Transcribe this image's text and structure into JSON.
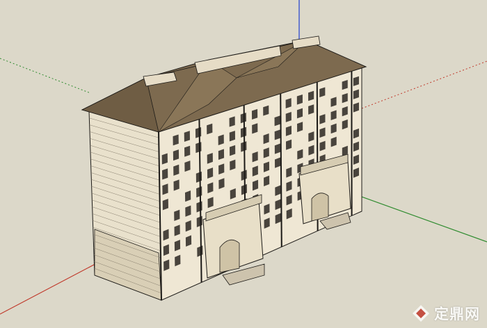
{
  "viewport": {
    "background_color": "#dcd8c9",
    "axis_colors": {
      "red": "#c0392b",
      "green": "#2e8b2e",
      "blue": "#1f3fd0"
    }
  },
  "model": {
    "roof_color": "#7d6a4f",
    "wall_color": "#efe7d4",
    "window_color": "#2b2722",
    "outline_color": "#1c1a17"
  },
  "watermark": {
    "text": "定鼎网",
    "logo_icon": "diamond-logo-icon",
    "color": "#ffffff"
  }
}
